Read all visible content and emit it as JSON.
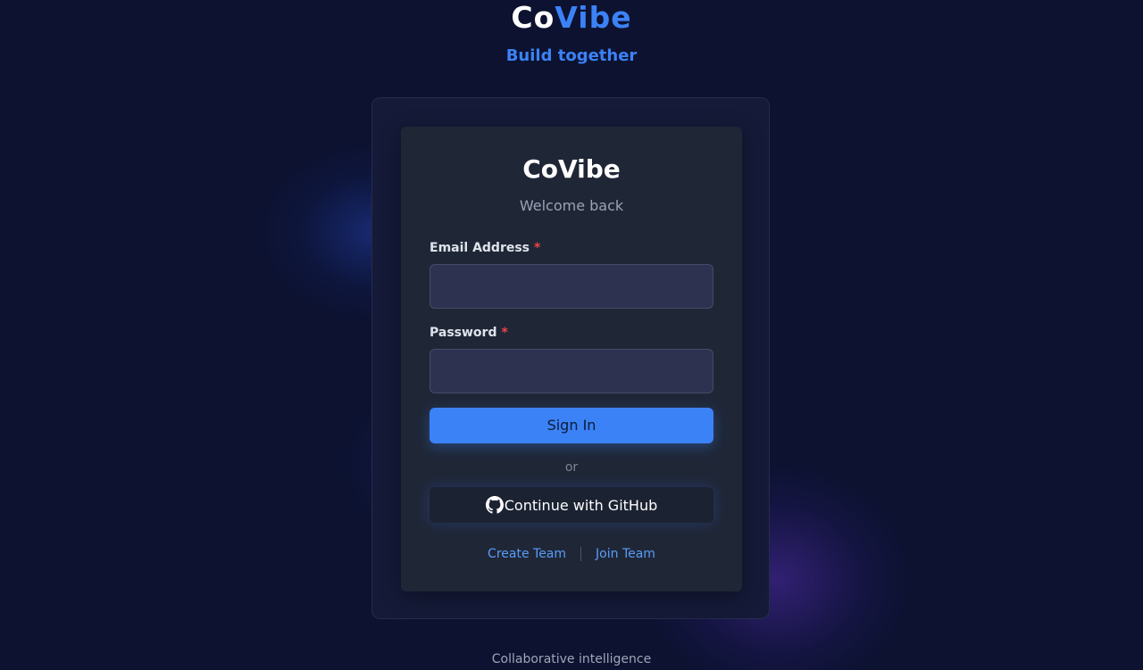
{
  "brand": {
    "title_prefix": "Co",
    "title_accent": "Vibe",
    "tagline": "Build together"
  },
  "login_card": {
    "title": "CoVibe",
    "subtitle": "Welcome back",
    "email": {
      "label": "Email Address",
      "required_marker": "*",
      "value": "",
      "placeholder": ""
    },
    "password": {
      "label": "Password",
      "required_marker": "*",
      "value": "",
      "placeholder": ""
    },
    "sign_in_label": "Sign In",
    "divider_text": "or",
    "github_label": "Continue with GitHub",
    "github_icon": "github-icon",
    "links": {
      "create_team": "Create Team",
      "join_team": "Join Team"
    }
  },
  "footer": {
    "text": "Collaborative intelligence"
  },
  "colors": {
    "background": "#0c1230",
    "accent": "#3b82f6",
    "required": "#ef4444",
    "card": "#1f2737",
    "input": "#2d3250"
  }
}
